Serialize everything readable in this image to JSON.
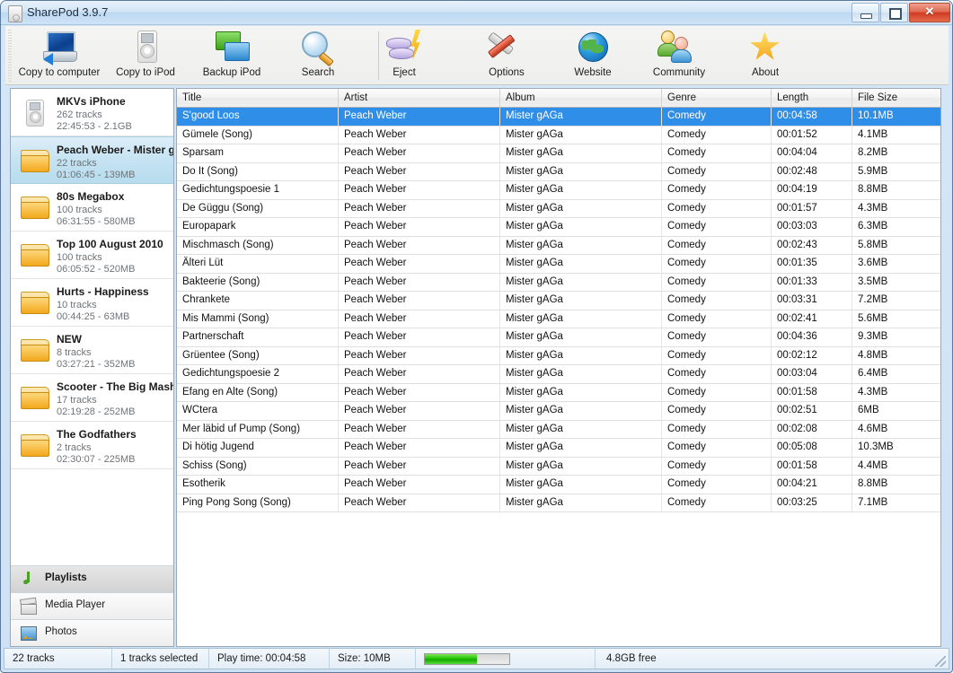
{
  "window": {
    "title": "SharePod 3.9.7",
    "app_icon": "ipod-icon",
    "controls": {
      "minimize": "minimize-button",
      "maximize": "maximize-button",
      "close_label": "✕"
    }
  },
  "toolbar": {
    "items": [
      {
        "label": "Copy to computer",
        "icon": "computer-icon"
      },
      {
        "label": "Copy to iPod",
        "icon": "ipod-icon"
      },
      {
        "label": "Backup iPod",
        "icon": "backup-icon"
      },
      {
        "label": "Search",
        "icon": "magnifier-icon"
      },
      {
        "label": "Eject",
        "icon": "eject-lightning-icon"
      },
      {
        "label": "Options",
        "icon": "tools-icon"
      },
      {
        "label": "Website",
        "icon": "globe-icon"
      },
      {
        "label": "Community",
        "icon": "people-icon"
      },
      {
        "label": "About",
        "icon": "star-icon"
      }
    ]
  },
  "sidebar": {
    "playlists": [
      {
        "name": "MKVs iPhone",
        "tracks": "262 tracks",
        "meta": "22:45:53 - 2.1GB",
        "icon": "ipod-device-icon",
        "selected": false
      },
      {
        "name": "Peach Weber - Mister gA",
        "tracks": "22 tracks",
        "meta": "01:06:45 - 139MB",
        "icon": "folder-icon",
        "selected": true
      },
      {
        "name": "80s Megabox",
        "tracks": "100 tracks",
        "meta": "06:31:55 - 580MB",
        "icon": "folder-icon",
        "selected": false
      },
      {
        "name": "Top 100 August 2010",
        "tracks": "100 tracks",
        "meta": "06:05:52 - 520MB",
        "icon": "folder-icon",
        "selected": false
      },
      {
        "name": "Hurts - Happiness",
        "tracks": "10 tracks",
        "meta": "00:44:25 - 63MB",
        "icon": "folder-icon",
        "selected": false
      },
      {
        "name": "NEW",
        "tracks": "8 tracks",
        "meta": "03:27:21 - 352MB",
        "icon": "folder-icon",
        "selected": false
      },
      {
        "name": "Scooter - The Big Mashup",
        "tracks": "17 tracks",
        "meta": "02:19:28 - 252MB",
        "icon": "folder-icon",
        "selected": false
      },
      {
        "name": "The Godfathers",
        "tracks": "2 tracks",
        "meta": "02:30:07 - 225MB",
        "icon": "folder-icon",
        "selected": false
      }
    ],
    "nav": [
      {
        "label": "Playlists",
        "icon": "music-note-icon",
        "active": true
      },
      {
        "label": "Media Player",
        "icon": "clapperboard-icon",
        "active": false
      },
      {
        "label": "Photos",
        "icon": "photo-icon",
        "active": false
      }
    ]
  },
  "table": {
    "columns": [
      "Title",
      "Artist",
      "Album",
      "Genre",
      "Length",
      "File Size"
    ],
    "rows": [
      {
        "title": "S'good Loos",
        "artist": "Peach Weber",
        "album": "Mister gAGa",
        "genre": "Comedy",
        "length": "00:04:58",
        "size": "10.1MB",
        "selected": true
      },
      {
        "title": "Gümele (Song)",
        "artist": "Peach Weber",
        "album": "Mister gAGa",
        "genre": "Comedy",
        "length": "00:01:52",
        "size": "4.1MB",
        "selected": false
      },
      {
        "title": "Sparsam",
        "artist": "Peach Weber",
        "album": "Mister gAGa",
        "genre": "Comedy",
        "length": "00:04:04",
        "size": "8.2MB",
        "selected": false
      },
      {
        "title": "Do It (Song)",
        "artist": "Peach Weber",
        "album": "Mister gAGa",
        "genre": "Comedy",
        "length": "00:02:48",
        "size": "5.9MB",
        "selected": false
      },
      {
        "title": "Gedichtungspoesie 1",
        "artist": "Peach Weber",
        "album": "Mister gAGa",
        "genre": "Comedy",
        "length": "00:04:19",
        "size": "8.8MB",
        "selected": false
      },
      {
        "title": "De Güggu (Song)",
        "artist": "Peach Weber",
        "album": "Mister gAGa",
        "genre": "Comedy",
        "length": "00:01:57",
        "size": "4.3MB",
        "selected": false
      },
      {
        "title": "Europapark",
        "artist": "Peach Weber",
        "album": "Mister gAGa",
        "genre": "Comedy",
        "length": "00:03:03",
        "size": "6.3MB",
        "selected": false
      },
      {
        "title": "Mischmasch (Song)",
        "artist": "Peach Weber",
        "album": "Mister gAGa",
        "genre": "Comedy",
        "length": "00:02:43",
        "size": "5.8MB",
        "selected": false
      },
      {
        "title": "Älteri Lüt",
        "artist": "Peach Weber",
        "album": "Mister gAGa",
        "genre": "Comedy",
        "length": "00:01:35",
        "size": "3.6MB",
        "selected": false
      },
      {
        "title": "Bakteerie (Song)",
        "artist": "Peach Weber",
        "album": "Mister gAGa",
        "genre": "Comedy",
        "length": "00:01:33",
        "size": "3.5MB",
        "selected": false
      },
      {
        "title": "Chrankete",
        "artist": "Peach Weber",
        "album": "Mister gAGa",
        "genre": "Comedy",
        "length": "00:03:31",
        "size": "7.2MB",
        "selected": false
      },
      {
        "title": "Mis Mammi (Song)",
        "artist": "Peach Weber",
        "album": "Mister gAGa",
        "genre": "Comedy",
        "length": "00:02:41",
        "size": "5.6MB",
        "selected": false
      },
      {
        "title": "Partnerschaft",
        "artist": "Peach Weber",
        "album": "Mister gAGa",
        "genre": "Comedy",
        "length": "00:04:36",
        "size": "9.3MB",
        "selected": false
      },
      {
        "title": "Grüentee (Song)",
        "artist": "Peach Weber",
        "album": "Mister gAGa",
        "genre": "Comedy",
        "length": "00:02:12",
        "size": "4.8MB",
        "selected": false
      },
      {
        "title": "Gedichtungspoesie 2",
        "artist": "Peach Weber",
        "album": "Mister gAGa",
        "genre": "Comedy",
        "length": "00:03:04",
        "size": "6.4MB",
        "selected": false
      },
      {
        "title": "Efang en Alte (Song)",
        "artist": "Peach Weber",
        "album": "Mister gAGa",
        "genre": "Comedy",
        "length": "00:01:58",
        "size": "4.3MB",
        "selected": false
      },
      {
        "title": "WCtera",
        "artist": "Peach Weber",
        "album": "Mister gAGa",
        "genre": "Comedy",
        "length": "00:02:51",
        "size": "6MB",
        "selected": false
      },
      {
        "title": "Mer läbid uf Pump (Song)",
        "artist": "Peach Weber",
        "album": "Mister gAGa",
        "genre": "Comedy",
        "length": "00:02:08",
        "size": "4.6MB",
        "selected": false
      },
      {
        "title": "Di hötig Jugend",
        "artist": "Peach Weber",
        "album": "Mister gAGa",
        "genre": "Comedy",
        "length": "00:05:08",
        "size": "10.3MB",
        "selected": false
      },
      {
        "title": "Schiss (Song)",
        "artist": "Peach Weber",
        "album": "Mister gAGa",
        "genre": "Comedy",
        "length": "00:01:58",
        "size": "4.4MB",
        "selected": false
      },
      {
        "title": "Esotherik",
        "artist": "Peach Weber",
        "album": "Mister gAGa",
        "genre": "Comedy",
        "length": "00:04:21",
        "size": "8.8MB",
        "selected": false
      },
      {
        "title": "Ping Pong Song (Song)",
        "artist": "Peach Weber",
        "album": "Mister gAGa",
        "genre": "Comedy",
        "length": "00:03:25",
        "size": "7.1MB",
        "selected": false
      }
    ]
  },
  "statusbar": {
    "track_count": "22 tracks",
    "selected_count": "1 tracks selected",
    "play_time": "Play time: 00:04:58",
    "size": "Size: 10MB",
    "free_space": "4.8GB free",
    "disk_used_percent": 62
  },
  "colors": {
    "selection_blue": "#2f8ee8",
    "progress_green": "#23c400",
    "sidebar_selected": "#c5e3f2",
    "close_red": "#cf3a22"
  }
}
